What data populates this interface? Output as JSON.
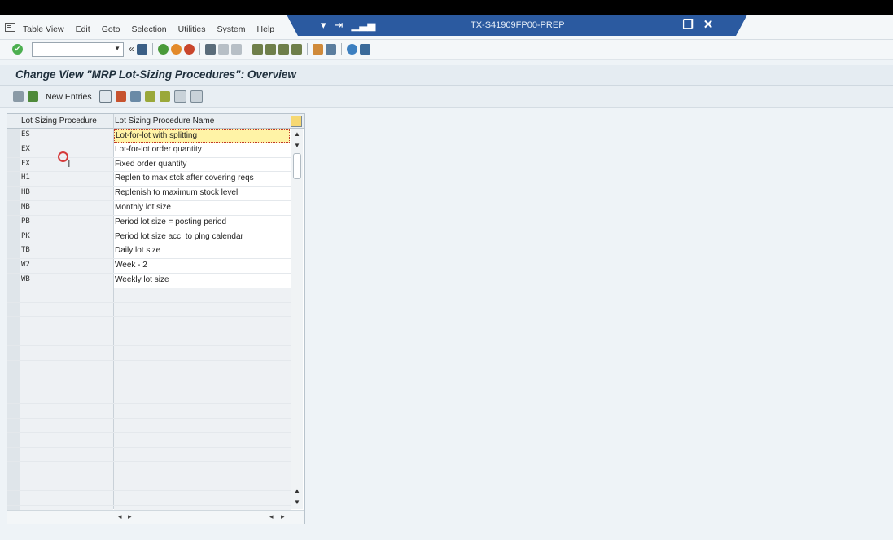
{
  "window": {
    "system_label": "TX-S41909FP00-PREP"
  },
  "menu": {
    "items": [
      "Table View",
      "Edit",
      "Goto",
      "Selection",
      "Utilities",
      "System",
      "Help"
    ]
  },
  "toolbar": {
    "command_field_value": ""
  },
  "screen": {
    "title": "Change View \"MRP Lot-Sizing Procedures\": Overview"
  },
  "app_toolbar": {
    "new_entries_label": "New Entries"
  },
  "table": {
    "columns": [
      "Lot Sizing Procedure",
      "Lot Sizing Procedure Name"
    ],
    "rows": [
      {
        "code": "ES",
        "name": "Lot-for-lot with splitting"
      },
      {
        "code": "EX",
        "name": "Lot-for-lot order quantity"
      },
      {
        "code": "FX",
        "name": "Fixed order quantity"
      },
      {
        "code": "H1",
        "name": "Replen to max stck after covering reqs"
      },
      {
        "code": "HB",
        "name": "Replenish to maximum stock level"
      },
      {
        "code": "MB",
        "name": "Monthly lot size"
      },
      {
        "code": "PB",
        "name": "Period lot size = posting period"
      },
      {
        "code": "PK",
        "name": "Period lot size acc. to plng calendar"
      },
      {
        "code": "TB",
        "name": "Daily lot size"
      },
      {
        "code": "W2",
        "name": "Week - 2"
      },
      {
        "code": "WB",
        "name": "Weekly lot size"
      }
    ]
  }
}
